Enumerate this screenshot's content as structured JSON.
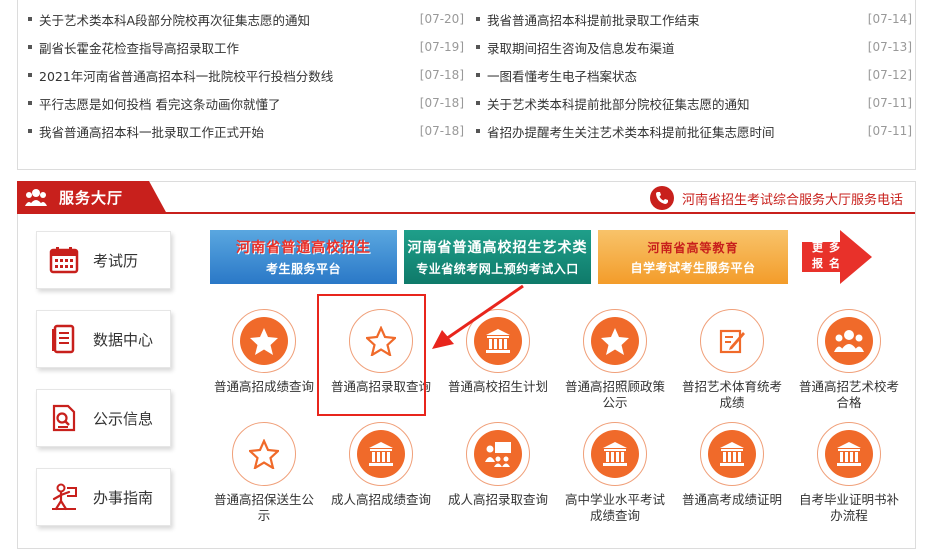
{
  "news": {
    "left": [
      {
        "title": "关于艺术类本科A段部分院校再次征集志愿的通知",
        "date": "[07-20]"
      },
      {
        "title": "副省长霍金花检查指导高招录取工作",
        "date": "[07-19]"
      },
      {
        "title": "2021年河南省普通高招本科一批院校平行投档分数线",
        "date": "[07-18]"
      },
      {
        "title": "平行志愿是如何投档 看完这条动画你就懂了",
        "date": "[07-18]"
      },
      {
        "title": "我省普通高招本科一批录取工作正式开始",
        "date": "[07-18]"
      }
    ],
    "right": [
      {
        "title": "我省普通高招本科提前批录取工作结束",
        "date": "[07-14]"
      },
      {
        "title": "录取期间招生咨询及信息发布渠道",
        "date": "[07-13]"
      },
      {
        "title": "一图看懂考生电子档案状态",
        "date": "[07-12]"
      },
      {
        "title": "关于艺术类本科提前批部分院校征集志愿的通知",
        "date": "[07-11]"
      },
      {
        "title": "省招办提醒考生关注艺术类本科提前批征集志愿时间",
        "date": "[07-11]"
      }
    ]
  },
  "service": {
    "title": "服务大厅",
    "phone_link": "河南省招生考试综合服务大厅服务电话",
    "menu": [
      {
        "label": "考试历",
        "icon": "calendar-icon"
      },
      {
        "label": "数据中心",
        "icon": "document-icon"
      },
      {
        "label": "公示信息",
        "icon": "file-search-icon"
      },
      {
        "label": "办事指南",
        "icon": "guide-person-icon"
      }
    ],
    "banners": [
      {
        "line1": "河南省普通高校招生",
        "line2": "考生服务平台"
      },
      {
        "line1": "河南省普通高校招生艺术类",
        "line2": "专业省统考网上预约考试入口"
      },
      {
        "line1": "河南省高等教育",
        "line2": "自学考试考生服务平台"
      }
    ],
    "more": "更多报名",
    "items_row1": [
      {
        "label": "普通高招成绩查询",
        "icon": "star-icon"
      },
      {
        "label": "普通高招录取查询",
        "icon": "star-outline-icon"
      },
      {
        "label": "普通高校招生计划",
        "icon": "building-icon"
      },
      {
        "label": "普通高招照顾政策公示",
        "icon": "star-icon"
      },
      {
        "label": "普招艺术体育统考成绩",
        "icon": "edit-icon"
      },
      {
        "label": "普通高招艺术校考合格",
        "icon": "people-icon"
      }
    ],
    "items_row2": [
      {
        "label": "普通高招保送生公示",
        "icon": "star-outline-icon"
      },
      {
        "label": "成人高招成绩查询",
        "icon": "building-icon"
      },
      {
        "label": "成人高招录取查询",
        "icon": "presenter-icon"
      },
      {
        "label": "高中学业水平考试成绩查询",
        "icon": "building-icon"
      },
      {
        "label": "普通高考成绩证明",
        "icon": "building-icon"
      },
      {
        "label": "自考毕业证明书补办流程",
        "icon": "building-icon"
      }
    ]
  },
  "colors": {
    "accent": "#c8201c",
    "orange": "#f06a2a"
  }
}
